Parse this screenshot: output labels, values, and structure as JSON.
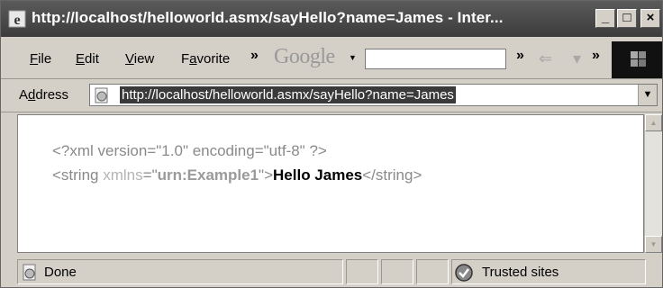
{
  "window": {
    "title": "http://localhost/helloworld.asmx/sayHello?name=James - Inter...",
    "minimize_glyph": "_",
    "maximize_glyph": "□",
    "close_glyph": "×"
  },
  "menubar": {
    "file": {
      "underlined": "F",
      "rest": "ile"
    },
    "edit": {
      "underlined": "E",
      "rest": "dit"
    },
    "view": {
      "underlined": "V",
      "rest": "iew"
    },
    "favorites": {
      "prefix": "F",
      "underlined": "a",
      "rest": "vorite"
    },
    "chevron": "»",
    "google_logo": "Google",
    "google_search_value": "",
    "back_icon": "left-arrow-icon",
    "forward_icon": "dash-icon"
  },
  "address": {
    "label_prefix": "A",
    "label_underlined": "d",
    "label_rest": "dress",
    "url": "http://localhost/helloworld.asmx/sayHello?name=James",
    "dropdown_glyph": "▼"
  },
  "content": {
    "xml_declaration": "<?xml version=\"1.0\" encoding=\"utf-8\" ?>",
    "open_tag_start": "<string ",
    "xmlns_attr": "xmlns",
    "equals_quote": "=\"",
    "namespace_value": "urn:Example1",
    "close_quote_bracket": "\">",
    "text_value": "Hello James",
    "closing_tag": "</string>"
  },
  "status": {
    "text": "Done",
    "zone": "Trusted sites"
  },
  "colors": {
    "titlebar": "#4a4a4a",
    "chrome": "#d4d0c8",
    "url_highlight": "#3a3a3a"
  }
}
